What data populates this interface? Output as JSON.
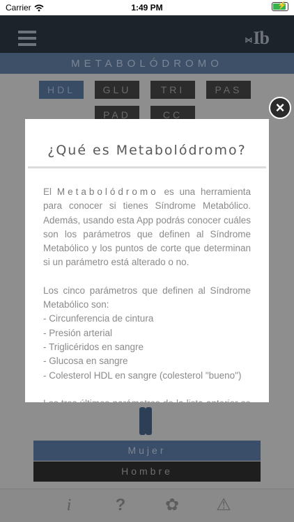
{
  "status_bar": {
    "carrier": "Carrier",
    "time": "1:49 PM"
  },
  "app": {
    "logo": "Ib",
    "title": "METABOLÓDROMO"
  },
  "params": [
    "HDL",
    "GLU",
    "TRI",
    "PAS",
    "PAD",
    "CC"
  ],
  "active_param": "HDL",
  "gender": {
    "woman": "Mujer",
    "man": "Hombre"
  },
  "toolbar": [
    {
      "icon": "info-icon",
      "glyph": "i"
    },
    {
      "icon": "help-icon",
      "glyph": "?"
    },
    {
      "icon": "award-icon",
      "glyph": "✿"
    },
    {
      "icon": "warning-icon",
      "glyph": "⚠"
    }
  ],
  "modal": {
    "title": "¿Qué es Metabolódromo?",
    "intro_prefix": "El",
    "intro_brand": "Metabolódromo",
    "intro_rest": "es una herramienta para conocer si tienes Síndrome Metabólico. Además, usando esta App podrás conocer cuáles son los parámetros que definen al Síndrome Metabólico y los puntos de corte que determinan si un parámetro está alterado o no.",
    "list_intro": "Los cinco parámetros que definen al Síndrome Metabólico son:",
    "list": [
      "- Circunferencia de cintura",
      "- Presión arterial",
      "- Triglicéridos en sangre",
      "- Glucosa en sangre",
      "- Colesterol HDL en sangre (colesterol \"bueno\")"
    ],
    "cut_text": "Los tres últimos parámetros de la lista anterior se deben"
  },
  "close_glyph": "×"
}
